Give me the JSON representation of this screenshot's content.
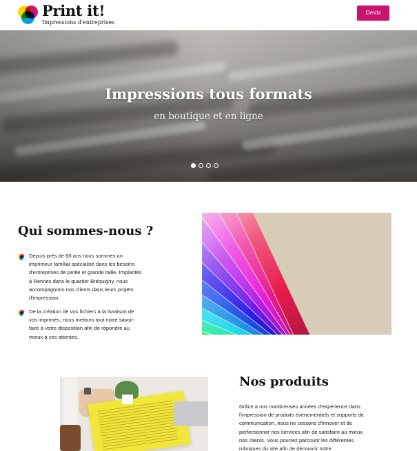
{
  "header": {
    "brand_name": "Print it!",
    "brand_tagline": "Impressions d'entreprises",
    "cta_label": "Devis",
    "accent_color": "#c8136e"
  },
  "hero": {
    "title": "Impressions tous formats",
    "subtitle": "en boutique et en ligne",
    "slides_total": 4,
    "active_slide": 1
  },
  "about": {
    "title": "Qui sommes-nous ?",
    "bullets": [
      "Depuis près de 60 ans nous sommes un imprimeur familial spécialisé dans les besoins d'entreprises de petite et grande taille. Implantés à Rennes dans le quartier Bréquigny, nous accompagnons nos clients dans leurs projets d'impression.",
      "De la création de vos fichiers à la livraison de vos imprimés, nous mettons tout notre savoir-faire à votre disposition afin de répondre au mieux à vos attentes."
    ]
  },
  "products": {
    "title": "Nos produits",
    "text": "Grâce à nos nombreuses années d'expérience dans l'impression de produits événementiels et supports de communication, nous ne cessons d'innover et de perfectionner nos services afin de satisfaire au mieux nos clients. Vous pourrez parcourir les différentes rubriques du site afin de découvrir notre"
  },
  "icons": {
    "logo": "cmy-circles-logo-icon",
    "bullet": "cmy-circles-bullet-icon"
  }
}
